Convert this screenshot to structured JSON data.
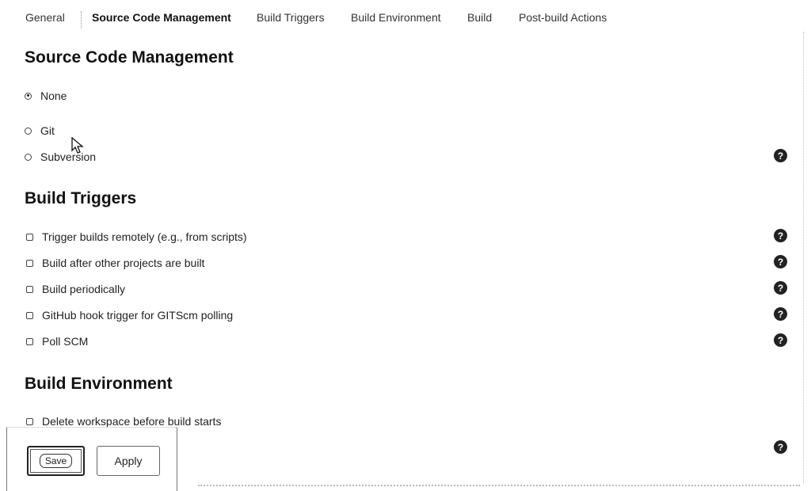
{
  "tabs": [
    {
      "label": "General"
    },
    {
      "label": "Source Code Management"
    },
    {
      "label": "Build Triggers"
    },
    {
      "label": "Build Environment"
    },
    {
      "label": "Build"
    },
    {
      "label": "Post-build Actions"
    }
  ],
  "scm": {
    "heading": "Source Code Management",
    "options": [
      {
        "label": "None",
        "selected": true
      },
      {
        "label": "Git",
        "selected": false
      },
      {
        "label": "Subversion",
        "selected": false
      }
    ]
  },
  "triggers": {
    "heading": "Build Triggers",
    "options": [
      {
        "label": "Trigger builds remotely (e.g., from scripts)",
        "checked": false
      },
      {
        "label": "Build after other projects are built",
        "checked": false
      },
      {
        "label": "Build periodically",
        "checked": false
      },
      {
        "label": "GitHub hook trigger for GITScm polling",
        "checked": false
      },
      {
        "label": "Poll SCM",
        "checked": false
      }
    ]
  },
  "environment": {
    "heading": "Build Environment",
    "options": [
      {
        "label": "Delete workspace before build starts",
        "checked": false
      }
    ]
  },
  "help_icon_glyph": "?",
  "buttons": {
    "save": "Save",
    "apply": "Apply"
  }
}
